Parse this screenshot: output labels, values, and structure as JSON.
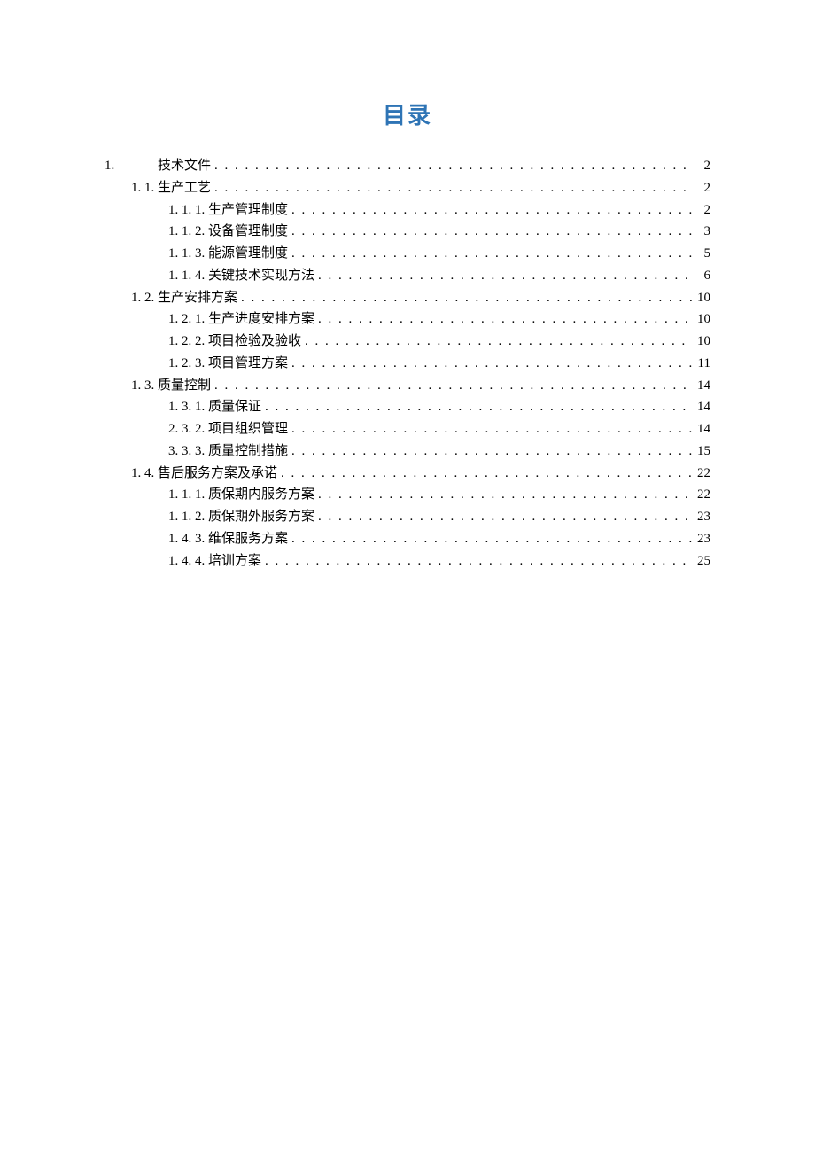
{
  "title": "目录",
  "entries": [
    {
      "level": 1,
      "num": "1.",
      "text": "技术文件",
      "page": "2",
      "numPadded": true
    },
    {
      "level": 2,
      "num": "1. 1.",
      "text": "生产工艺",
      "page": "2"
    },
    {
      "level": 3,
      "num": "1. 1. 1.",
      "text": "生产管理制度",
      "page": "2"
    },
    {
      "level": 3,
      "num": "1. 1. 2.",
      "text": " 设备管理制度",
      "page": "3"
    },
    {
      "level": 3,
      "num": "1. 1. 3.",
      "text": " 能源管理制度",
      "page": "5"
    },
    {
      "level": 3,
      "num": "1.  1. 4.",
      "text": "关键技术实现方法",
      "page": "6"
    },
    {
      "level": 2,
      "num": "1. 2.",
      "text": "  生产安排方案",
      "page": "10"
    },
    {
      "level": 3,
      "num": "1. 2. 1.",
      "text": " 生产进度安排方案",
      "page": "10"
    },
    {
      "level": 3,
      "num": "1. 2. 2.",
      "text": "项目检验及验收",
      "page": "10"
    },
    {
      "level": 3,
      "num": "1.  2. 3.",
      "text": "项目管理方案",
      "page": "11"
    },
    {
      "level": 2,
      "num": "1. 3.",
      "text": "  质量控制",
      "page": "14"
    },
    {
      "level": 3,
      "num": "1.  3. 1.",
      "text": "质量保证",
      "page": "14"
    },
    {
      "level": 3,
      "num": "2.  3. 2.",
      "text": "项目组织管理",
      "page": "14"
    },
    {
      "level": 3,
      "num": "3.  3. 3.",
      "text": "质量控制措施",
      "page": "15"
    },
    {
      "level": 2,
      "num": "1.  4.",
      "text": "售后服务方案及承诺",
      "page": "22"
    },
    {
      "level": 3,
      "num": "1. 1. 1.",
      "text": " 质保期内服务方案",
      "page": "22"
    },
    {
      "level": 3,
      "num": "1. 1. 2.",
      "text": " 质保期外服务方案",
      "page": "23"
    },
    {
      "level": 3,
      "num": "1. 4. 3.",
      "text": "维保服务方案",
      "page": "23"
    },
    {
      "level": 3,
      "num": "1. 4. 4.",
      "text": "培训方案",
      "page": "25"
    }
  ]
}
